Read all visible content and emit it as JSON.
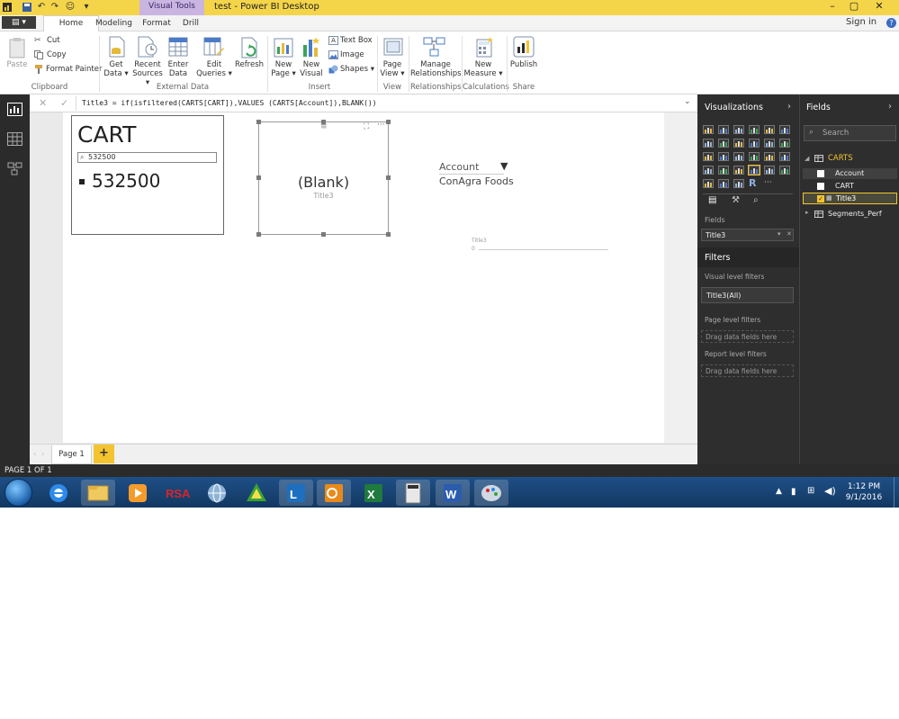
{
  "window": {
    "title": "test - Power BI Desktop",
    "context_tab": "Visual Tools",
    "file_menu": "File"
  },
  "tabs": [
    {
      "label": "Home",
      "active": true
    },
    {
      "label": "Modeling",
      "active": false
    },
    {
      "label": "Format",
      "active": false
    },
    {
      "label": "Drill",
      "active": false
    }
  ],
  "signin": "Sign in",
  "ribbon": {
    "clipboard": {
      "paste": "Paste",
      "cut": "Cut",
      "copy": "Copy",
      "format_painter": "Format Painter",
      "group": "Clipboard"
    },
    "external": {
      "get_data": [
        "Get",
        "Data ▾"
      ],
      "recent_sources": [
        "Recent",
        "Sources ▾"
      ],
      "enter_data": [
        "Enter",
        "Data"
      ],
      "edit_queries": [
        "Edit",
        "Queries ▾"
      ],
      "refresh": "Refresh",
      "group": "External Data"
    },
    "insert": {
      "new_page": [
        "New",
        "Page ▾"
      ],
      "new_visual": [
        "New",
        "Visual"
      ],
      "text_box": "Text Box",
      "image": "Image",
      "shapes": "Shapes ▾",
      "group": "Insert"
    },
    "view": {
      "page_view": [
        "Page",
        "View ▾"
      ],
      "group": "View"
    },
    "relationships": {
      "manage": [
        "Manage",
        "Relationships"
      ],
      "group": "Relationships"
    },
    "calculations": {
      "new_measure": [
        "New",
        "Measure ▾"
      ],
      "group": "Calculations"
    },
    "share": {
      "publish": "Publish",
      "group": "Share"
    }
  },
  "formula": {
    "text": "Title3 = if(isfiltered(CARTS[CART]),VALUES (CARTS[Account]),BLANK())"
  },
  "canvas": {
    "slicer_cart": {
      "title": "CART",
      "search_value": "532500",
      "item": "532500"
    },
    "blank_card": {
      "value": "(Blank)",
      "label": "Title3"
    },
    "account_slicer": {
      "header": "Account",
      "value": "ConAgra Foods"
    },
    "mini_chart": {
      "label": "Title3",
      "axis_value": "0"
    }
  },
  "page_tabs": {
    "page1": "Page 1",
    "add": "+"
  },
  "status": "PAGE 1 OF 1",
  "visualizations": {
    "header": "Visualizations",
    "fields_label": "Fields",
    "field_well_value": "Title3",
    "filters_header": "Filters",
    "visual_level": "Visual level filters",
    "visual_filter_item": "Title3(All)",
    "page_level": "Page level filters",
    "page_drop": "Drag data fields here",
    "report_level": "Report level filters",
    "report_drop": "Drag data fields here"
  },
  "fields": {
    "header": "Fields",
    "search_placeholder": "Search",
    "tables": [
      {
        "name": "CARTS",
        "expanded": true,
        "fields": [
          {
            "name": "Account",
            "checked": false
          },
          {
            "name": "CART",
            "checked": false
          },
          {
            "name": "Title3",
            "checked": true
          }
        ]
      },
      {
        "name": "Segments_Perf",
        "expanded": false,
        "fields": []
      }
    ]
  },
  "taskbar": {
    "time": "1:12 PM",
    "date": "9/1/2016"
  },
  "colors": {
    "accent_yellow": "#f4c430",
    "pane_dark": "#2e2e2e",
    "taskbar_blue": "#1f4f86",
    "context_purple": "#c9b5e0"
  }
}
